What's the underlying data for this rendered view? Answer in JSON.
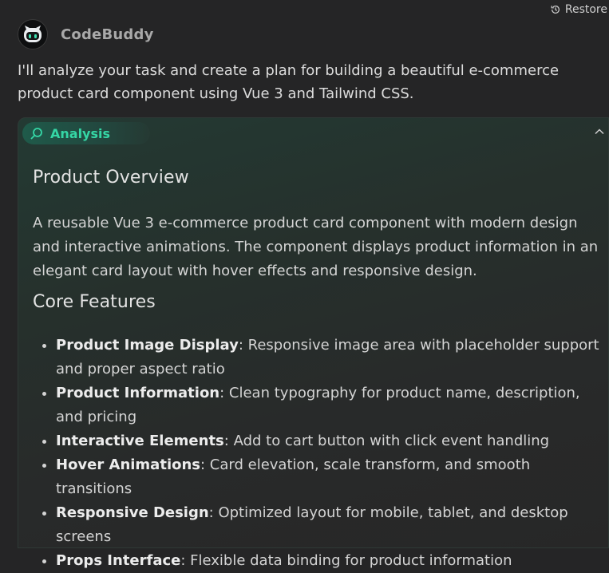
{
  "restore": {
    "label": "Restore"
  },
  "bot": {
    "name": "CodeBuddy"
  },
  "message": {
    "intro": "I'll analyze your task and create a plan for building a beautiful e-commerce product card component using Vue 3 and Tailwind CSS."
  },
  "analysis": {
    "pill_label": "Analysis",
    "overview_title": "Product Overview",
    "overview_text": "A reusable Vue 3 e-commerce product card component with modern design and interactive animations. The component displays product information in an elegant card layout with hover effects and responsive design.",
    "features_title": "Core Features",
    "features": [
      {
        "name": "Product Image Display",
        "desc": ": Responsive image area with placeholder support and proper aspect ratio"
      },
      {
        "name": "Product Information",
        "desc": ": Clean typography for product name, description, and pricing"
      },
      {
        "name": "Interactive Elements",
        "desc": ": Add to cart button with click event handling"
      },
      {
        "name": "Hover Animations",
        "desc": ": Card elevation, scale transform, and smooth transitions"
      },
      {
        "name": "Responsive Design",
        "desc": ": Optimized layout for mobile, tablet, and desktop screens"
      },
      {
        "name": "Props Interface",
        "desc": ": Flexible data binding for product information"
      }
    ]
  },
  "colors": {
    "accent": "#35d6a5",
    "background": "#252526"
  },
  "icons": {
    "restore": "history-icon",
    "avatar": "robot-icon",
    "pill": "search-icon",
    "collapse": "chevron-up-icon"
  }
}
